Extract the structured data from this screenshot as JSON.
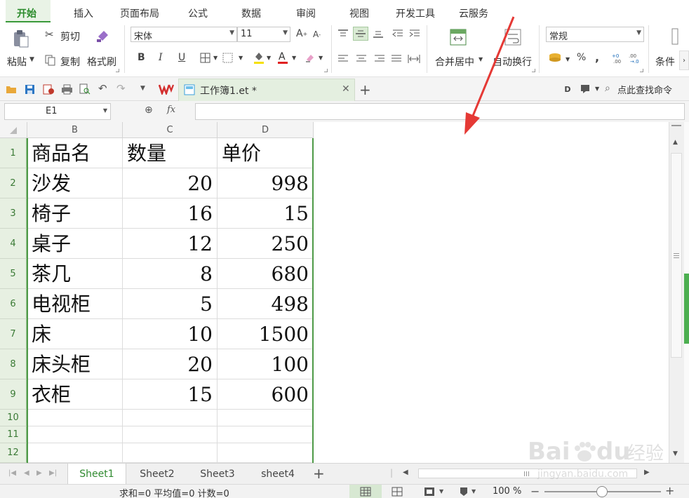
{
  "menu": {
    "tabs": [
      "开始",
      "插入",
      "页面布局",
      "公式",
      "数据",
      "审阅",
      "视图",
      "开发工具",
      "云服务"
    ],
    "active": "开始"
  },
  "ribbon": {
    "paste": "粘贴",
    "cut": "剪切",
    "copy": "复制",
    "format_painter": "格式刷",
    "font_name": "宋体",
    "font_size": "11",
    "bold": "B",
    "italic": "I",
    "underline": "U",
    "merge_center": "合并居中",
    "wrap_text": "自动换行",
    "number_format": "常规",
    "percent": "%",
    "comma": ",",
    "conditional": "条件"
  },
  "doc_tab": {
    "title": "工作簿1.et *"
  },
  "search_command": "点此查找命令",
  "formula_bar": {
    "name_box": "E1",
    "fx": "fx",
    "formula": ""
  },
  "columns": [
    "B",
    "C",
    "D"
  ],
  "rows": [
    {
      "num": "1",
      "name": "商品名",
      "qty": "数量",
      "price": "单价"
    },
    {
      "num": "2",
      "name": "沙发",
      "qty": "20",
      "price": "998"
    },
    {
      "num": "3",
      "name": "椅子",
      "qty": "16",
      "price": "15"
    },
    {
      "num": "4",
      "name": "桌子",
      "qty": "12",
      "price": "250"
    },
    {
      "num": "5",
      "name": "茶几",
      "qty": "8",
      "price": "680"
    },
    {
      "num": "6",
      "name": "电视柜",
      "qty": "5",
      "price": "498"
    },
    {
      "num": "7",
      "name": "床",
      "qty": "10",
      "price": "1500"
    },
    {
      "num": "8",
      "name": "床头柜",
      "qty": "20",
      "price": "100"
    },
    {
      "num": "9",
      "name": "衣柜",
      "qty": "15",
      "price": "600"
    },
    {
      "num": "10",
      "name": "",
      "qty": "",
      "price": ""
    },
    {
      "num": "11",
      "name": "",
      "qty": "",
      "price": ""
    },
    {
      "num": "12",
      "name": "",
      "qty": "",
      "price": ""
    }
  ],
  "sheets": [
    "Sheet1",
    "Sheet2",
    "Sheet3",
    "sheet4"
  ],
  "active_sheet": "Sheet1",
  "status": {
    "summary": "求和=0  平均值=0  计数=0",
    "zoom": "100 %"
  },
  "watermark": {
    "brand": "Bai",
    "brand2": "du",
    "cn": "经验",
    "url": "jingyan.baidu.com"
  },
  "colors": {
    "accent": "#2a8a2a",
    "selection_border": "#4e9a47",
    "row_header_bg": "#e7f0e2",
    "arrow": "#e53935"
  }
}
